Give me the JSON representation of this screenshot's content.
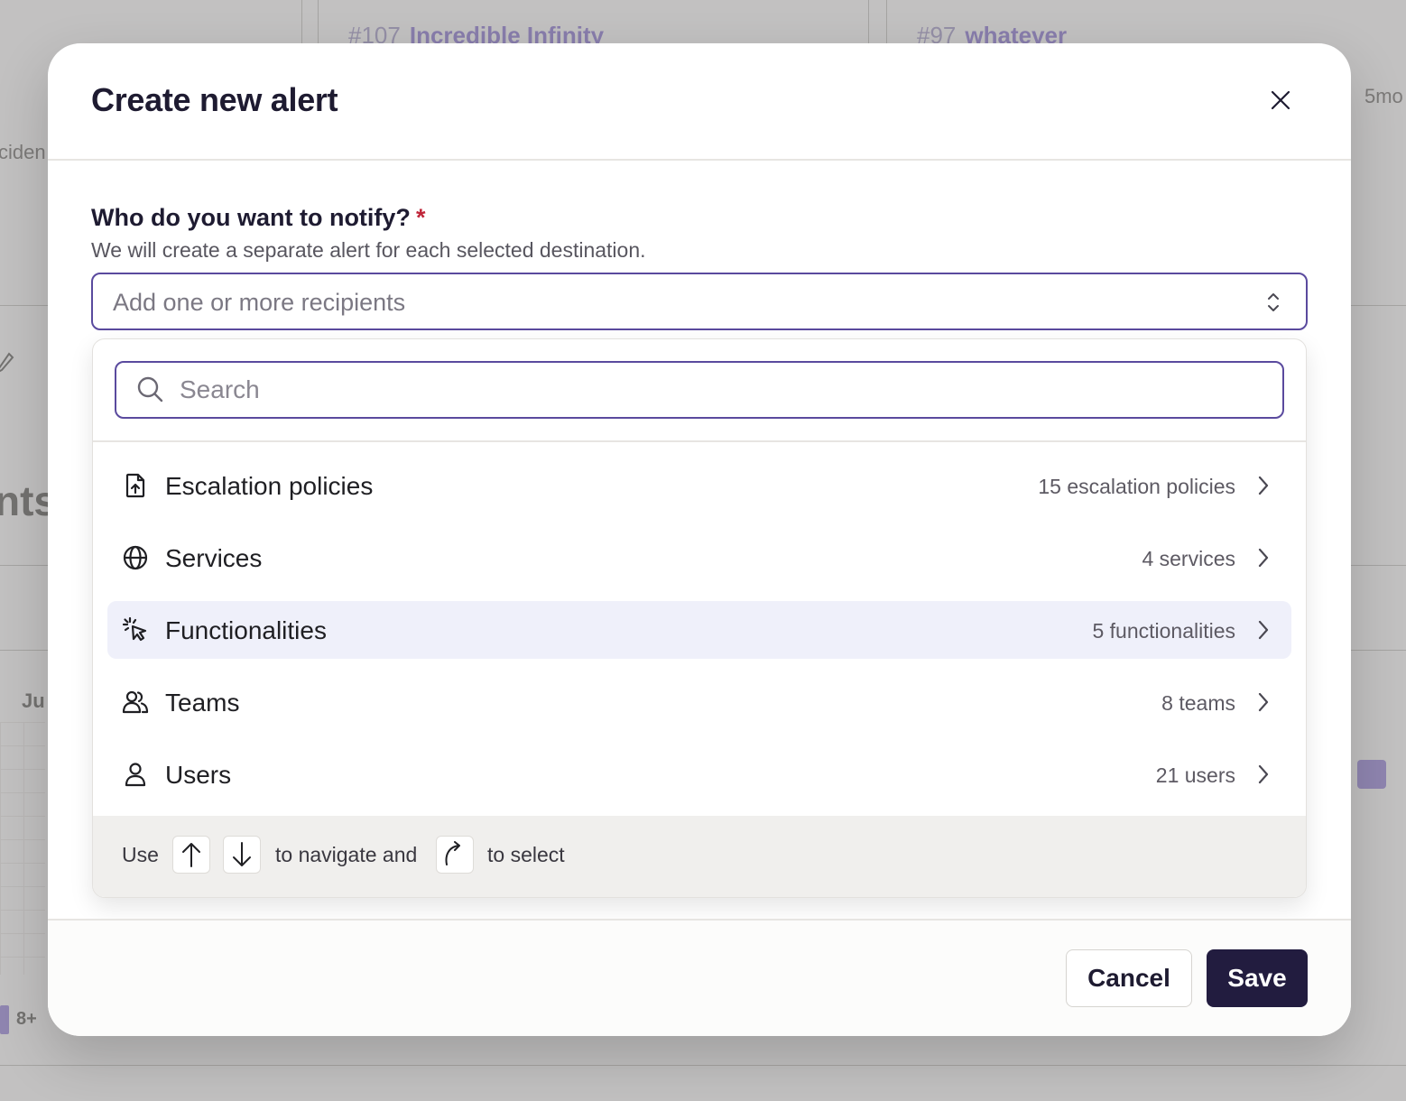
{
  "background": {
    "cards": [
      {
        "num": "#107",
        "title": "Incredible Infinity"
      },
      {
        "num": "#97",
        "title": "whatever"
      }
    ],
    "side_text_left": "ciden",
    "side_text_right": "5mo",
    "big_text": "nts",
    "month_label": "Ju",
    "legend_label": "8+",
    "accent_color": "#b2a6dc"
  },
  "modal": {
    "title": "Create new alert",
    "close_icon": "close-icon",
    "field": {
      "label": "Who do you want to notify?",
      "required_marker": "*",
      "help": "We will create a separate alert for each selected destination.",
      "placeholder": "Add one or more recipients"
    },
    "dropdown": {
      "search_placeholder": "Search",
      "options": [
        {
          "label": "Escalation policies",
          "count": "15 escalation policies",
          "icon": "file-upload-icon",
          "active": false
        },
        {
          "label": "Services",
          "count": "4 services",
          "icon": "globe-icon",
          "active": false
        },
        {
          "label": "Functionalities",
          "count": "5 functionalities",
          "icon": "pointer-click-icon",
          "active": true
        },
        {
          "label": "Teams",
          "count": "8 teams",
          "icon": "users-icon",
          "active": false
        },
        {
          "label": "Users",
          "count": "21 users",
          "icon": "user-icon",
          "active": false
        }
      ],
      "hint": {
        "use": "Use",
        "navigate": "to navigate and",
        "select": "to select"
      }
    },
    "footer": {
      "cancel_label": "Cancel",
      "save_label": "Save"
    }
  },
  "colors": {
    "primary": "#221c3f",
    "focus_border": "#5a4a9e",
    "active_row": "#eff0fa",
    "required": "#c0263a"
  }
}
